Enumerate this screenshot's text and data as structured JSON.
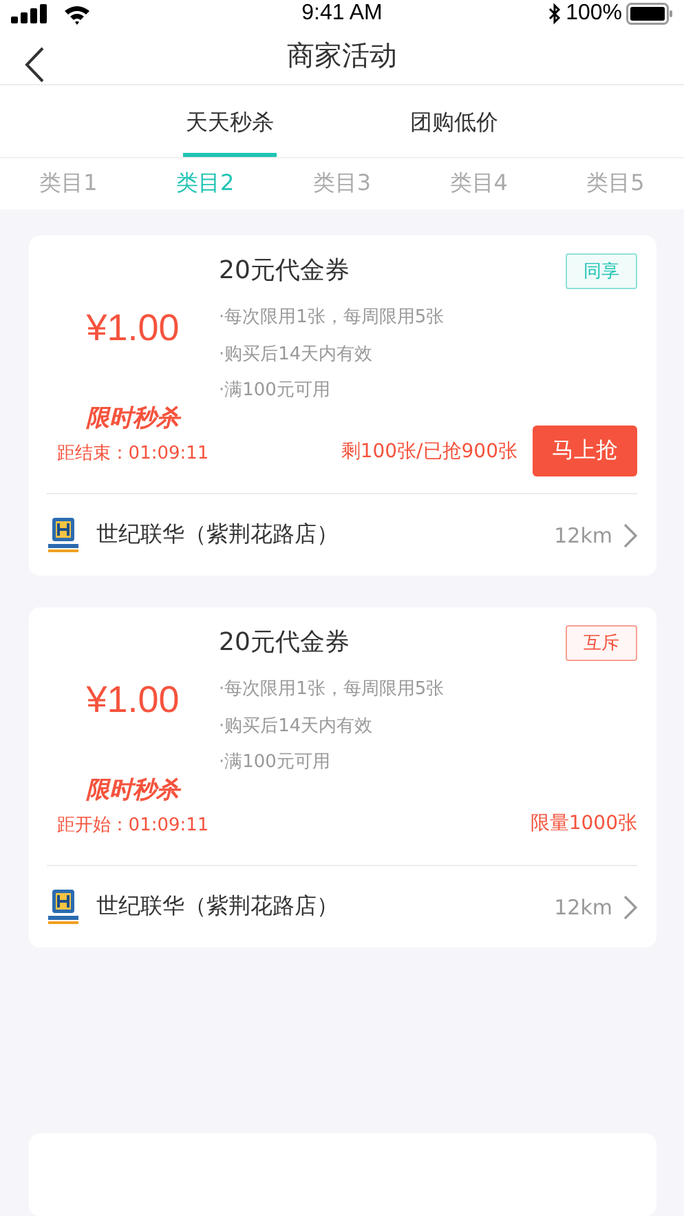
{
  "status_bar": {
    "time": "9:41 AM",
    "battery": "100%"
  },
  "nav": {
    "title": "商家活动"
  },
  "tabs": [
    {
      "label": "天天秒杀",
      "selected": true
    },
    {
      "label": "团购低价",
      "selected": false
    }
  ],
  "categories": [
    {
      "label": "类目1",
      "selected": false
    },
    {
      "label": "类目2",
      "selected": true
    },
    {
      "label": "类目3",
      "selected": false
    },
    {
      "label": "类目4",
      "selected": false
    },
    {
      "label": "类目5",
      "selected": false
    }
  ],
  "deals": [
    {
      "title": "20元代金券",
      "tag": {
        "label": "同享",
        "kind": "shared"
      },
      "price": "¥1.00",
      "flash_label": "限时秒杀",
      "countdown": "距结束：01:09:11",
      "rules": [
        "·每次限用1张，每周限用5张",
        "·购买后14天内有效",
        "·满100元可用"
      ],
      "stock": "剩100张/已抢900张",
      "kind": "buy",
      "button": "马上抢",
      "store": "世纪联华（紫荆花路店）",
      "distance": "12km"
    },
    {
      "title": "20元代金券",
      "tag": {
        "label": "互斥",
        "kind": "exclusive"
      },
      "price": "¥1.00",
      "flash_label": "限时秒杀",
      "countdown": "距开始：01:09:11",
      "rules": [
        "·每次限用1张，每周限用5张",
        "·购买后14天内有效",
        "·满100元可用"
      ],
      "stock": "限量1000张",
      "kind": "upcoming",
      "store": "世纪联华（紫荆花路店）",
      "distance": "12km"
    }
  ],
  "peek_card": {
    "kind": "card"
  }
}
